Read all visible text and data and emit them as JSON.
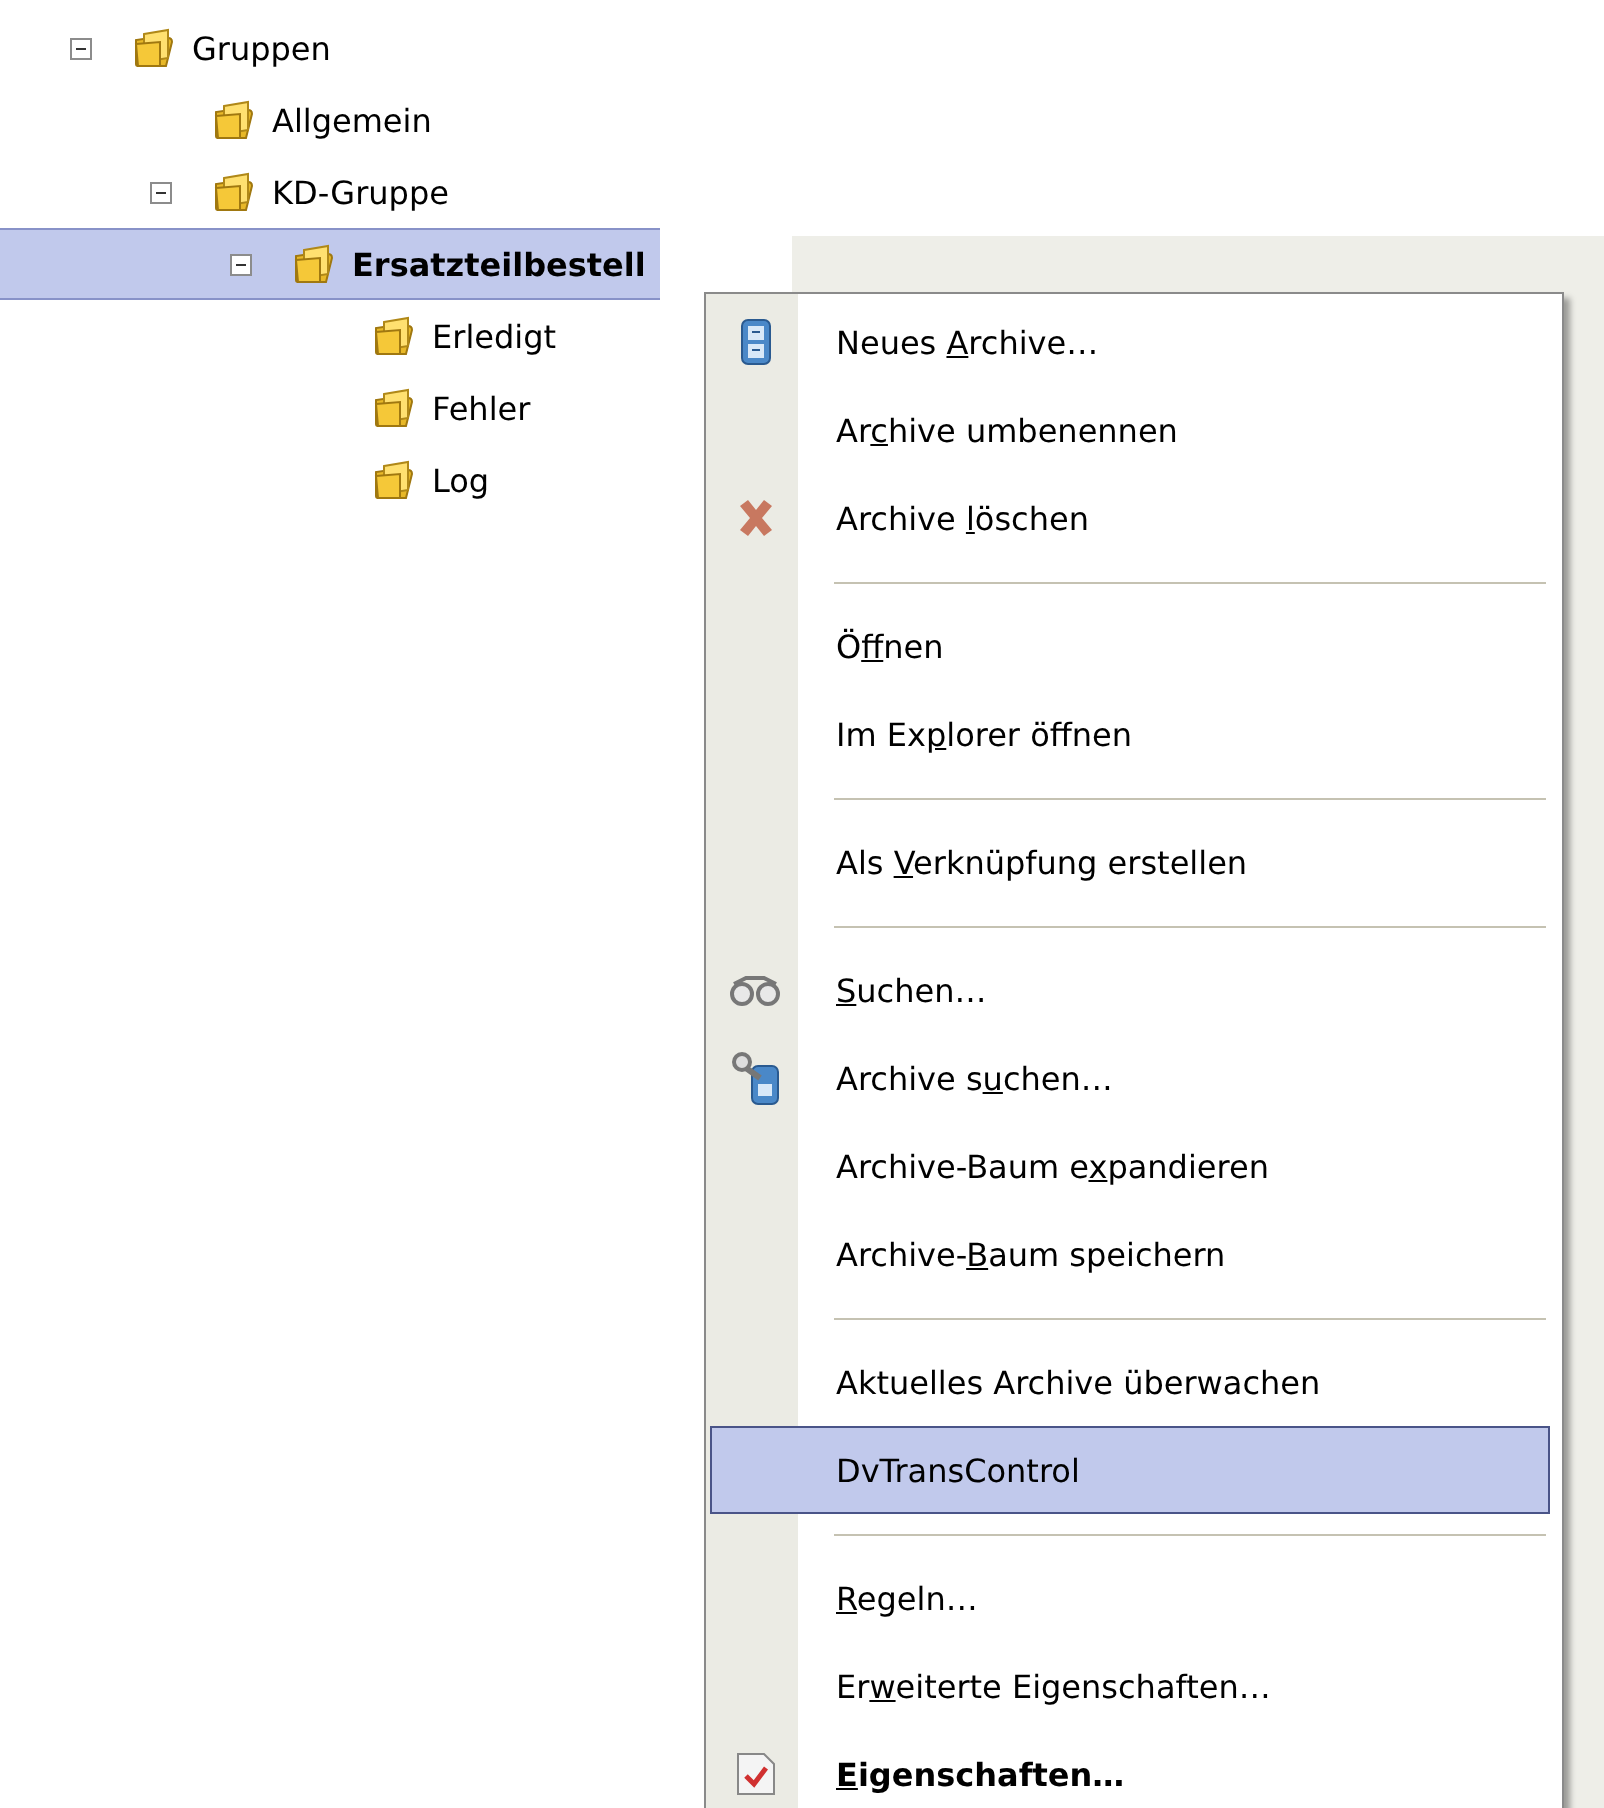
{
  "tree": [
    {
      "label": "Gruppen",
      "expanded": true,
      "selected": false,
      "children": [
        {
          "label": "Allgemein",
          "selected": false
        },
        {
          "label": "KD-Gruppe",
          "expanded": true,
          "selected": false,
          "children": [
            {
              "label": "Ersatzteilbestell",
              "expanded": true,
              "selected": true,
              "children": [
                {
                  "label": "Erledigt",
                  "selected": false
                },
                {
                  "label": "Fehler",
                  "selected": false
                },
                {
                  "label": "Log",
                  "selected": false
                }
              ]
            }
          ]
        }
      ]
    }
  ],
  "context_menu": {
    "items": [
      {
        "kind": "item",
        "label": [
          {
            "text": "Neues ",
            "mnemonic": false
          },
          {
            "text": "A",
            "mnemonic": true
          },
          {
            "text": "rchive…",
            "mnemonic": false
          }
        ],
        "selected": false,
        "default": false
      },
      {
        "kind": "item",
        "label": [
          {
            "text": "Ar",
            "mnemonic": false
          },
          {
            "text": "c",
            "mnemonic": true
          },
          {
            "text": "hive umbenennen",
            "mnemonic": false
          }
        ],
        "selected": false,
        "default": false
      },
      {
        "kind": "item",
        "label": [
          {
            "text": "Archive ",
            "mnemonic": false
          },
          {
            "text": "l",
            "mnemonic": true
          },
          {
            "text": "öschen",
            "mnemonic": false
          }
        ],
        "selected": false,
        "default": false
      },
      {
        "kind": "separator"
      },
      {
        "kind": "item",
        "label": [
          {
            "text": "Ö",
            "mnemonic": false
          },
          {
            "text": "f",
            "mnemonic": true
          },
          {
            "text": "fnen",
            "mnemonic": false
          }
        ],
        "selected": false,
        "default": false
      },
      {
        "kind": "item",
        "label": [
          {
            "text": "Im Ex",
            "mnemonic": false
          },
          {
            "text": "p",
            "mnemonic": true
          },
          {
            "text": "lorer öffnen",
            "mnemonic": false
          }
        ],
        "selected": false,
        "default": false
      },
      {
        "kind": "separator"
      },
      {
        "kind": "item",
        "label": [
          {
            "text": "Als ",
            "mnemonic": false
          },
          {
            "text": "V",
            "mnemonic": true
          },
          {
            "text": "erknüpfung erstellen",
            "mnemonic": false
          }
        ],
        "selected": false,
        "default": false
      },
      {
        "kind": "separator"
      },
      {
        "kind": "item",
        "label": [
          {
            "text": "S",
            "mnemonic": true
          },
          {
            "text": "uchen…",
            "mnemonic": false
          }
        ],
        "selected": false,
        "default": false
      },
      {
        "kind": "item",
        "label": [
          {
            "text": "Archive s",
            "mnemonic": false
          },
          {
            "text": "u",
            "mnemonic": true
          },
          {
            "text": "chen…",
            "mnemonic": false
          }
        ],
        "selected": false,
        "default": false
      },
      {
        "kind": "item",
        "label": [
          {
            "text": "Archive-Baum e",
            "mnemonic": false
          },
          {
            "text": "x",
            "mnemonic": true
          },
          {
            "text": "pandieren",
            "mnemonic": false
          }
        ],
        "selected": false,
        "default": false
      },
      {
        "kind": "item",
        "label": [
          {
            "text": "Archive-",
            "mnemonic": false
          },
          {
            "text": "B",
            "mnemonic": true
          },
          {
            "text": "aum speichern",
            "mnemonic": false
          }
        ],
        "selected": false,
        "default": false
      },
      {
        "kind": "separator"
      },
      {
        "kind": "item",
        "label": [
          {
            "text": "Aktuelles Archive überwachen",
            "mnemonic": false
          }
        ],
        "selected": false,
        "default": false
      },
      {
        "kind": "item",
        "label": [
          {
            "text": "DvTransControl",
            "mnemonic": false
          }
        ],
        "selected": true,
        "default": false
      },
      {
        "kind": "separator"
      },
      {
        "kind": "item",
        "label": [
          {
            "text": "R",
            "mnemonic": true
          },
          {
            "text": "egeln…",
            "mnemonic": false
          }
        ],
        "selected": false,
        "default": false
      },
      {
        "kind": "item",
        "label": [
          {
            "text": "Er",
            "mnemonic": false
          },
          {
            "text": "w",
            "mnemonic": true
          },
          {
            "text": "eiterte Eigenschaften…",
            "mnemonic": false
          }
        ],
        "selected": false,
        "default": false
      },
      {
        "kind": "item",
        "label": [
          {
            "text": "E",
            "mnemonic": true
          },
          {
            "text": "igenschaften…",
            "mnemonic": false
          }
        ],
        "selected": false,
        "default": true
      }
    ]
  }
}
